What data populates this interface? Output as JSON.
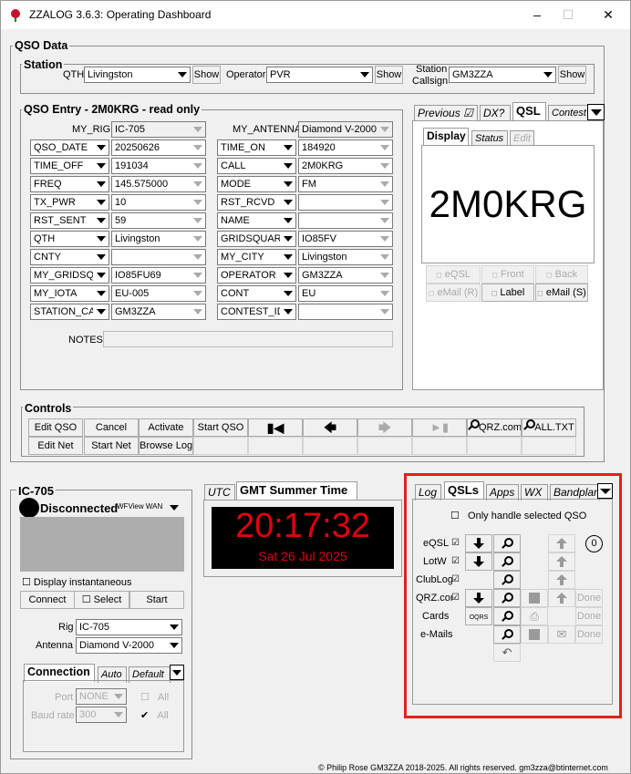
{
  "window": {
    "title": "ZZALOG 3.6.3: Operating Dashboard",
    "accent": "#c8102e"
  },
  "qso_data": {
    "title": "QSO Data",
    "station": {
      "title": "Station",
      "qth_label": "QTH",
      "qth_value": "Livingston",
      "operator_label": "Operator",
      "operator_value": "PVR",
      "callsign_label_1": "Station",
      "callsign_label_2": "Callsign",
      "callsign_value": "GM3ZZA",
      "show_label": "Show"
    },
    "entry": {
      "title": "QSO Entry - 2M0KRG - read only",
      "my_rig_label": "MY_RIG",
      "my_rig_value": "IC-705",
      "my_antenna_label": "MY_ANTENNA",
      "my_antenna_value": "Diamond V-2000",
      "left_fields": [
        {
          "name": "QSO_DATE",
          "value": "20250626"
        },
        {
          "name": "TIME_OFF",
          "value": "191034"
        },
        {
          "name": "FREQ",
          "value": "145.575000"
        },
        {
          "name": "TX_PWR",
          "value": "10"
        },
        {
          "name": "RST_SENT",
          "value": "59"
        },
        {
          "name": "QTH",
          "value": "Livingston"
        },
        {
          "name": "CNTY",
          "value": ""
        },
        {
          "name": "MY_GRIDSQ",
          "value": "IO85FU69"
        },
        {
          "name": "MY_IOTA",
          "value": "EU-005"
        },
        {
          "name": "STATION_CA",
          "value": "GM3ZZA"
        }
      ],
      "right_fields": [
        {
          "name": "TIME_ON",
          "value": "184920"
        },
        {
          "name": "CALL",
          "value": "2M0KRG"
        },
        {
          "name": "MODE",
          "value": "FM"
        },
        {
          "name": "RST_RCVD",
          "value": ""
        },
        {
          "name": "NAME",
          "value": ""
        },
        {
          "name": "GRIDSQUAR",
          "value": "IO85FV"
        },
        {
          "name": "MY_CITY",
          "value": "Livingston"
        },
        {
          "name": "OPERATOR",
          "value": "GM3ZZA"
        },
        {
          "name": "CONT",
          "value": "EU"
        },
        {
          "name": "CONTEST_ID",
          "value": ""
        }
      ],
      "notes_label": "NOTES"
    },
    "qsl_panel": {
      "tabs": [
        "Previous ☑",
        "DX?",
        "QSL",
        "Contest"
      ],
      "subtabs": [
        "Display",
        "Status",
        "Edit"
      ],
      "callsign": "2M0KRG",
      "buttons": [
        "eQSL",
        "Front",
        "Back",
        "eMail (R)",
        "Label",
        "eMail (S)"
      ]
    },
    "controls": {
      "title": "Controls",
      "row1": [
        "Edit QSO",
        "Cancel",
        "Activate",
        "Start QSO"
      ],
      "row2": [
        "Edit Net",
        "Start Net",
        "Browse Log"
      ],
      "qrz_label": "QRZ.com",
      "alltxt_label": "ALL.TXT"
    }
  },
  "rig": {
    "title": "IC-705",
    "status": "Disconnected",
    "wfview": "WFView WAN",
    "display_instantaneous": "Display instantaneous",
    "buttons": [
      "Connect",
      "Select",
      "Start"
    ],
    "rig_label": "Rig",
    "rig_value": "IC-705",
    "antenna_label": "Antenna",
    "antenna_value": "Diamond V-2000",
    "conn_tabs": [
      "Connection",
      "Auto",
      "Default"
    ],
    "port_label": "Port",
    "port_value": "NONE",
    "baud_label": "Baud rate",
    "baud_value": "300",
    "all_label": "All"
  },
  "clock": {
    "tabs": [
      "UTC",
      "GMT Summer Time"
    ],
    "time": "20:17:32",
    "date": "Sat 26 Jul 2025",
    "color": "#e0000f"
  },
  "qsls": {
    "tabs": [
      "Log",
      "QSLs",
      "Apps",
      "WX",
      "Bandplan"
    ],
    "only_selected": "Only handle selected QSO",
    "count": "0",
    "rows": [
      "eQSL",
      "LotW",
      "ClubLog",
      "QRZ.com",
      "Cards",
      "e-Mails"
    ],
    "oqrs": "OQRS",
    "done": "Done",
    "highlight": "#e02020"
  },
  "footer": "© Philip Rose GM3ZZA 2018-2025. All rights reserved. gm3zza@btinternet.com"
}
